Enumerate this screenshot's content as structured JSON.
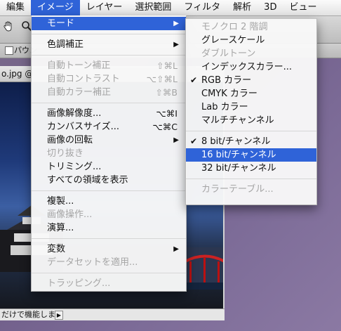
{
  "menubar": {
    "items": [
      {
        "label": "編集",
        "active": false
      },
      {
        "label": "イメージ",
        "active": true
      },
      {
        "label": "レイヤー",
        "active": false
      },
      {
        "label": "選択範囲",
        "active": false
      },
      {
        "label": "フィルタ",
        "active": false
      },
      {
        "label": "解析",
        "active": false
      },
      {
        "label": "3D",
        "active": false
      },
      {
        "label": "ビュー",
        "active": false
      }
    ]
  },
  "toolbar": {
    "checkbox_label": "パウン"
  },
  "document": {
    "title": "o.jpg @",
    "status_text": "だけで機能します"
  },
  "image_menu": {
    "items": [
      {
        "type": "item",
        "label": "モード",
        "submenu": true,
        "highlighted": true
      },
      {
        "type": "sep"
      },
      {
        "type": "item",
        "label": "色調補正",
        "submenu": true
      },
      {
        "type": "sep"
      },
      {
        "type": "item",
        "label": "自動トーン補正",
        "shortcut": "⇧⌘L",
        "disabled": true
      },
      {
        "type": "item",
        "label": "自動コントラスト",
        "shortcut": "⌥⇧⌘L",
        "disabled": true
      },
      {
        "type": "item",
        "label": "自動カラー補正",
        "shortcut": "⇧⌘B",
        "disabled": true
      },
      {
        "type": "sep"
      },
      {
        "type": "item",
        "label": "画像解像度...",
        "shortcut": "⌥⌘I"
      },
      {
        "type": "item",
        "label": "カンバスサイズ...",
        "shortcut": "⌥⌘C"
      },
      {
        "type": "item",
        "label": "画像の回転",
        "submenu": true
      },
      {
        "type": "item",
        "label": "切り抜き",
        "disabled": true
      },
      {
        "type": "item",
        "label": "トリミング..."
      },
      {
        "type": "item",
        "label": "すべての領域を表示"
      },
      {
        "type": "sep"
      },
      {
        "type": "item",
        "label": "複製..."
      },
      {
        "type": "item",
        "label": "画像操作...",
        "disabled": true
      },
      {
        "type": "item",
        "label": "演算..."
      },
      {
        "type": "sep"
      },
      {
        "type": "item",
        "label": "変数",
        "submenu": true
      },
      {
        "type": "item",
        "label": "データセットを適用...",
        "disabled": true
      },
      {
        "type": "sep"
      },
      {
        "type": "item",
        "label": "トラッピング...",
        "disabled": true
      }
    ]
  },
  "mode_submenu": {
    "items": [
      {
        "type": "item",
        "label": "モノクロ 2 階調",
        "disabled": true
      },
      {
        "type": "item",
        "label": "グレースケール"
      },
      {
        "type": "item",
        "label": "ダブルトーン",
        "disabled": true
      },
      {
        "type": "item",
        "label": "インデックスカラー..."
      },
      {
        "type": "item",
        "label": "RGB カラー",
        "checked": true
      },
      {
        "type": "item",
        "label": "CMYK カラー"
      },
      {
        "type": "item",
        "label": "Lab カラー"
      },
      {
        "type": "item",
        "label": "マルチチャンネル"
      },
      {
        "type": "sep"
      },
      {
        "type": "item",
        "label": "8 bit/チャンネル",
        "checked": true
      },
      {
        "type": "item",
        "label": "16 bit/チャンネル",
        "highlighted": true
      },
      {
        "type": "item",
        "label": "32 bit/チャンネル"
      },
      {
        "type": "sep"
      },
      {
        "type": "item",
        "label": "カラーテーブル...",
        "disabled": true
      }
    ]
  },
  "glyphs": {
    "submenu_arrow": "▶",
    "checkmark": "✔"
  },
  "colors": {
    "highlight": "#2f63d8",
    "disabled_text": "#a5a5a5"
  }
}
